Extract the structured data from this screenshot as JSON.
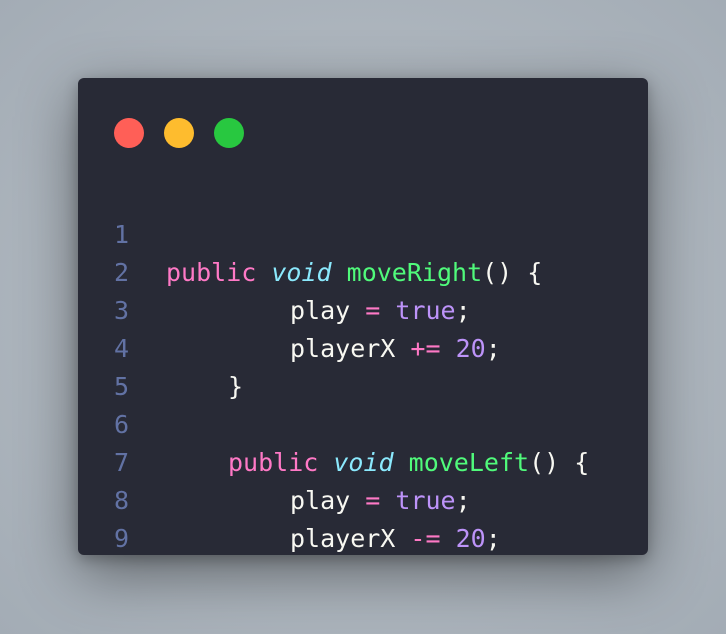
{
  "colors": {
    "background": "#aeb6be",
    "editor_bg": "#282a36",
    "close_dot": "#ff5f57",
    "minimize_dot": "#febc2e",
    "maximize_dot": "#28c840",
    "line_number": "#6272a4",
    "keyword": "#ff79c6",
    "type": "#8be9fd",
    "function": "#50fa7b",
    "number": "#bd93f9",
    "text": "#f8f8f2"
  },
  "lines": [
    {
      "num": "1",
      "tokens": {
        "kw": "public",
        "type": "void",
        "fn": "moveRight",
        "rest": "() {"
      }
    },
    {
      "num": "2",
      "tokens": {
        "var": "play",
        "op": "=",
        "val": "true",
        "end": ";"
      }
    },
    {
      "num": "3",
      "tokens": {
        "var": "playerX",
        "op": "+=",
        "val": "20",
        "end": ";"
      }
    },
    {
      "num": "4",
      "tokens": {
        "brace": "}"
      }
    },
    {
      "num": "5",
      "tokens": {}
    },
    {
      "num": "6",
      "tokens": {
        "kw": "public",
        "type": "void",
        "fn": "moveLeft",
        "rest": "() {"
      }
    },
    {
      "num": "7",
      "tokens": {
        "var": "play",
        "op": "=",
        "val": "true",
        "end": ";"
      }
    },
    {
      "num": "8",
      "tokens": {
        "var": "playerX",
        "op": "-=",
        "val": "20",
        "end": ";"
      }
    },
    {
      "num": "9",
      "tokens": {
        "brace": "}"
      }
    }
  ]
}
